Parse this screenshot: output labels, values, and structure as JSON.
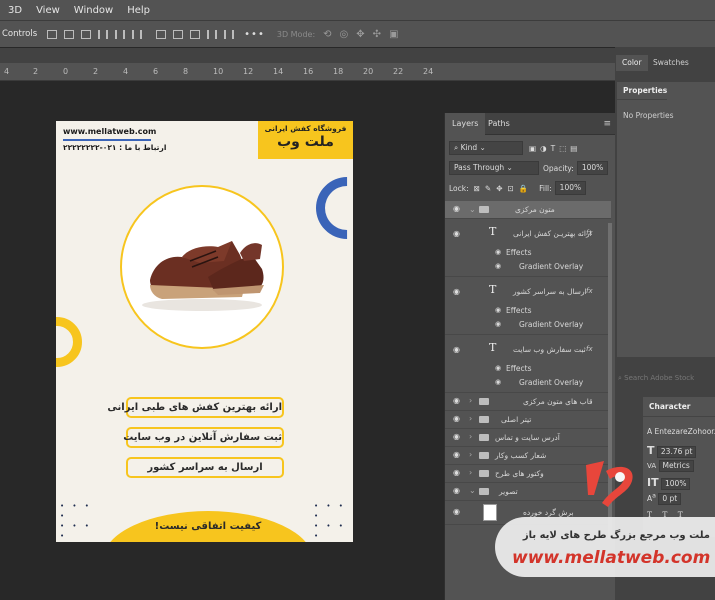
{
  "menu": [
    "3D",
    "View",
    "Window",
    "Help"
  ],
  "options_bar": {
    "label": "Controls",
    "mode_3d": "3D Mode:"
  },
  "ruler_ticks": [
    "4",
    "2",
    "0",
    "2",
    "4",
    "6",
    "8",
    "10",
    "12",
    "14",
    "16",
    "18",
    "20",
    "22",
    "24"
  ],
  "flyer": {
    "website": "www.mellatweb.com",
    "phone": "ارتباط با ما : ۰۲۱-۲۲۲۲۲۲۲۲",
    "tag_line1": "فروشگاه کفش ایرانی",
    "tag_line2": "ملت وب",
    "pill1": "ارائه بهترین کفش های طبی ایرانی",
    "pill2": "ثبت سفارش آنلاین در وب سایت",
    "pill3": "ارسال به سراسر کشور",
    "bottom": "کیفیت اتفاقی نیست!",
    "colors": {
      "yellow": "#f7c51e",
      "blue": "#3a64b8",
      "bg": "#f4f1ea"
    }
  },
  "layers_panel": {
    "tabs": [
      "Layers",
      "Paths"
    ],
    "filter": "Kind",
    "blend": "Pass Through",
    "opacity_label": "Opacity:",
    "opacity_value": "100%",
    "lock_label": "Lock:",
    "fill_label": "Fill:",
    "fill_value": "100%",
    "groups": {
      "g1": "متون مرکزی",
      "t1": "ارائه بهتریـن کفش ایرانی",
      "t2": "ارسال به سراسر کشور",
      "t3": "ثبت سفارش وب سایت",
      "effects": "Effects",
      "gradient": "Gradient Overlay",
      "fx": "fx",
      "g2": "قاب های متون مرکزی",
      "g3": "تیتر اصلی",
      "g4": "آدرس سایت و تماس",
      "g5": "شعار کسب وکار",
      "g6": "وکتور های طرح",
      "g7": "تصویر",
      "l8": "برش گرد خورده"
    }
  },
  "right_panel": {
    "tabs": [
      "Color",
      "Swatches"
    ],
    "properties_title": "Properties",
    "properties_sub": "No Properties",
    "stock": "Search Adobe Stock",
    "character_title": "Character",
    "font": "A EntezareZohoor...",
    "size": "23.76 pt",
    "kerning": "Metrics",
    "scale": "100%",
    "baseline": "0 pt"
  },
  "watermark": {
    "persian": "ملت وب مرجع بزرگ طرح های لایه باز",
    "url": "www.mellatweb.com"
  }
}
